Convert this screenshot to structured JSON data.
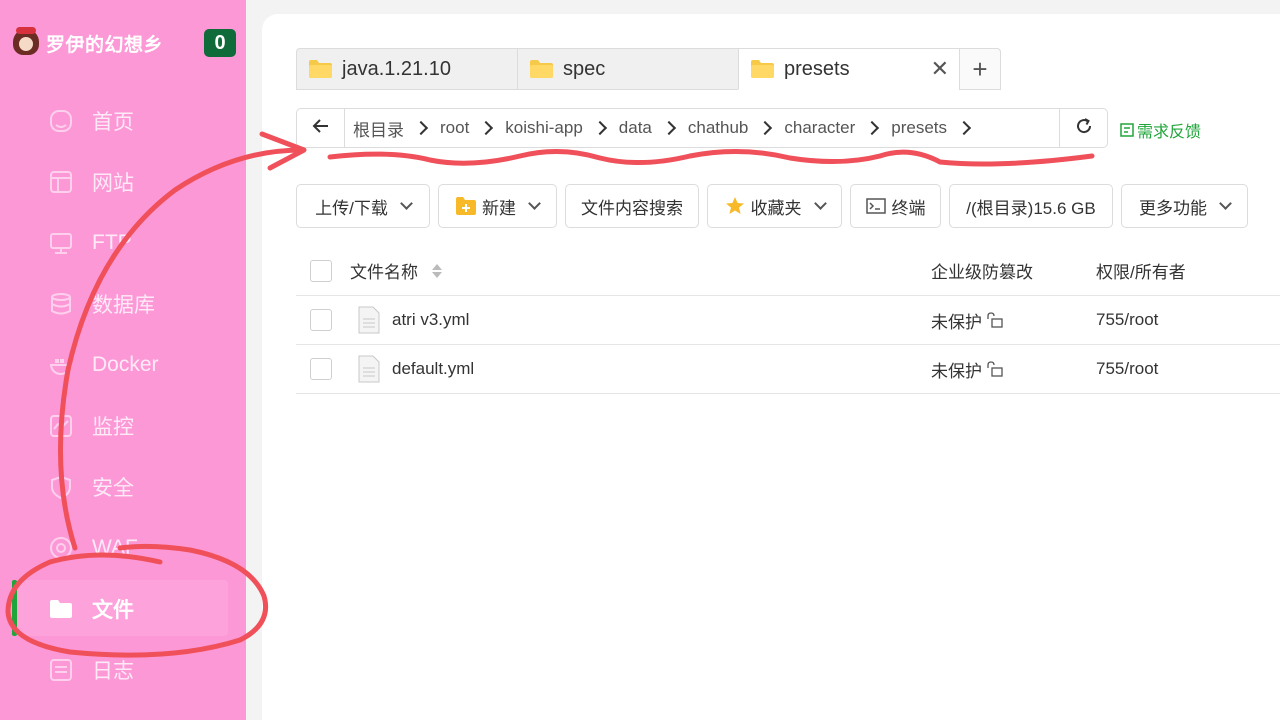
{
  "sidebar": {
    "brand_name": "罗伊的幻想乡",
    "badge_count": "0",
    "items": [
      {
        "label": "首页",
        "icon": "home-icon"
      },
      {
        "label": "网站",
        "icon": "website-icon"
      },
      {
        "label": "FTP",
        "icon": "ftp-icon"
      },
      {
        "label": "数据库",
        "icon": "database-icon"
      },
      {
        "label": "Docker",
        "icon": "docker-icon"
      },
      {
        "label": "监控",
        "icon": "monitor-icon"
      },
      {
        "label": "安全",
        "icon": "shield-icon"
      },
      {
        "label": "WAF",
        "icon": "waf-icon"
      },
      {
        "label": "文件",
        "icon": "folder-icon",
        "active": true
      },
      {
        "label": "日志",
        "icon": "log-icon"
      }
    ],
    "active_color": "#20a53a",
    "background": "#fd98d7"
  },
  "tabs": [
    {
      "label": "java.1.21.10"
    },
    {
      "label": "spec"
    },
    {
      "label": "presets",
      "active": true,
      "closable": true
    }
  ],
  "path": {
    "crumbs": [
      "根目录",
      "root",
      "koishi-app",
      "data",
      "chathub",
      "character",
      "presets"
    ]
  },
  "feedback_label": "需求反馈",
  "toolbar": {
    "upload": "上传/下载",
    "new": "新建",
    "search": "文件内容搜索",
    "favorites": "收藏夹",
    "terminal": "终端",
    "disk": "/(根目录)15.6 GB",
    "more": "更多功能"
  },
  "table": {
    "headers": {
      "name": "文件名称",
      "protection": "企业级防篡改",
      "permission": "权限/所有者"
    },
    "rows": [
      {
        "name": "atri v3.yml",
        "protection": "未保护",
        "permission": "755/root"
      },
      {
        "name": "default.yml",
        "protection": "未保护",
        "permission": "755/root"
      }
    ]
  },
  "annotation_color": "#f0505a"
}
